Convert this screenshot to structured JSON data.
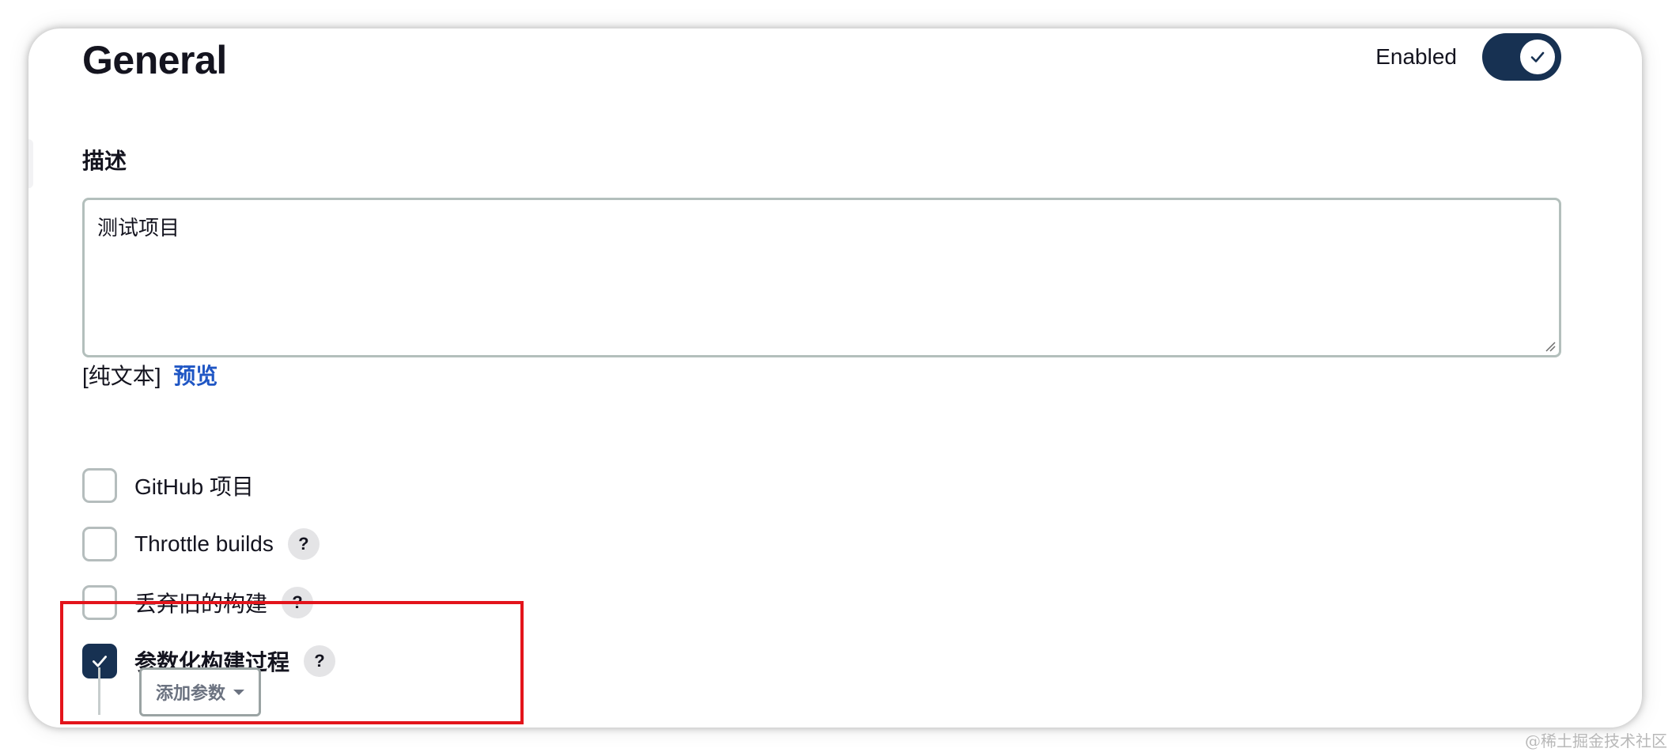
{
  "header": {
    "title": "General",
    "enabled_label": "Enabled",
    "enabled": true
  },
  "description": {
    "label": "描述",
    "value": "测试项目",
    "format_text": "[纯文本]",
    "preview_link": "预览"
  },
  "options": [
    {
      "label": "GitHub 项目",
      "checked": false,
      "has_help": false
    },
    {
      "label": "Throttle builds",
      "checked": false,
      "has_help": true
    },
    {
      "label": "丢弃旧的构建",
      "checked": false,
      "has_help": true
    },
    {
      "label": "参数化构建过程",
      "checked": true,
      "has_help": true
    }
  ],
  "help_glyph": "?",
  "add_param_button": {
    "label": "添加参数"
  },
  "watermark": "@稀土掘金技术社区",
  "colors": {
    "accent": "#173152",
    "link": "#1f56c4",
    "highlight": "#e3141b"
  }
}
